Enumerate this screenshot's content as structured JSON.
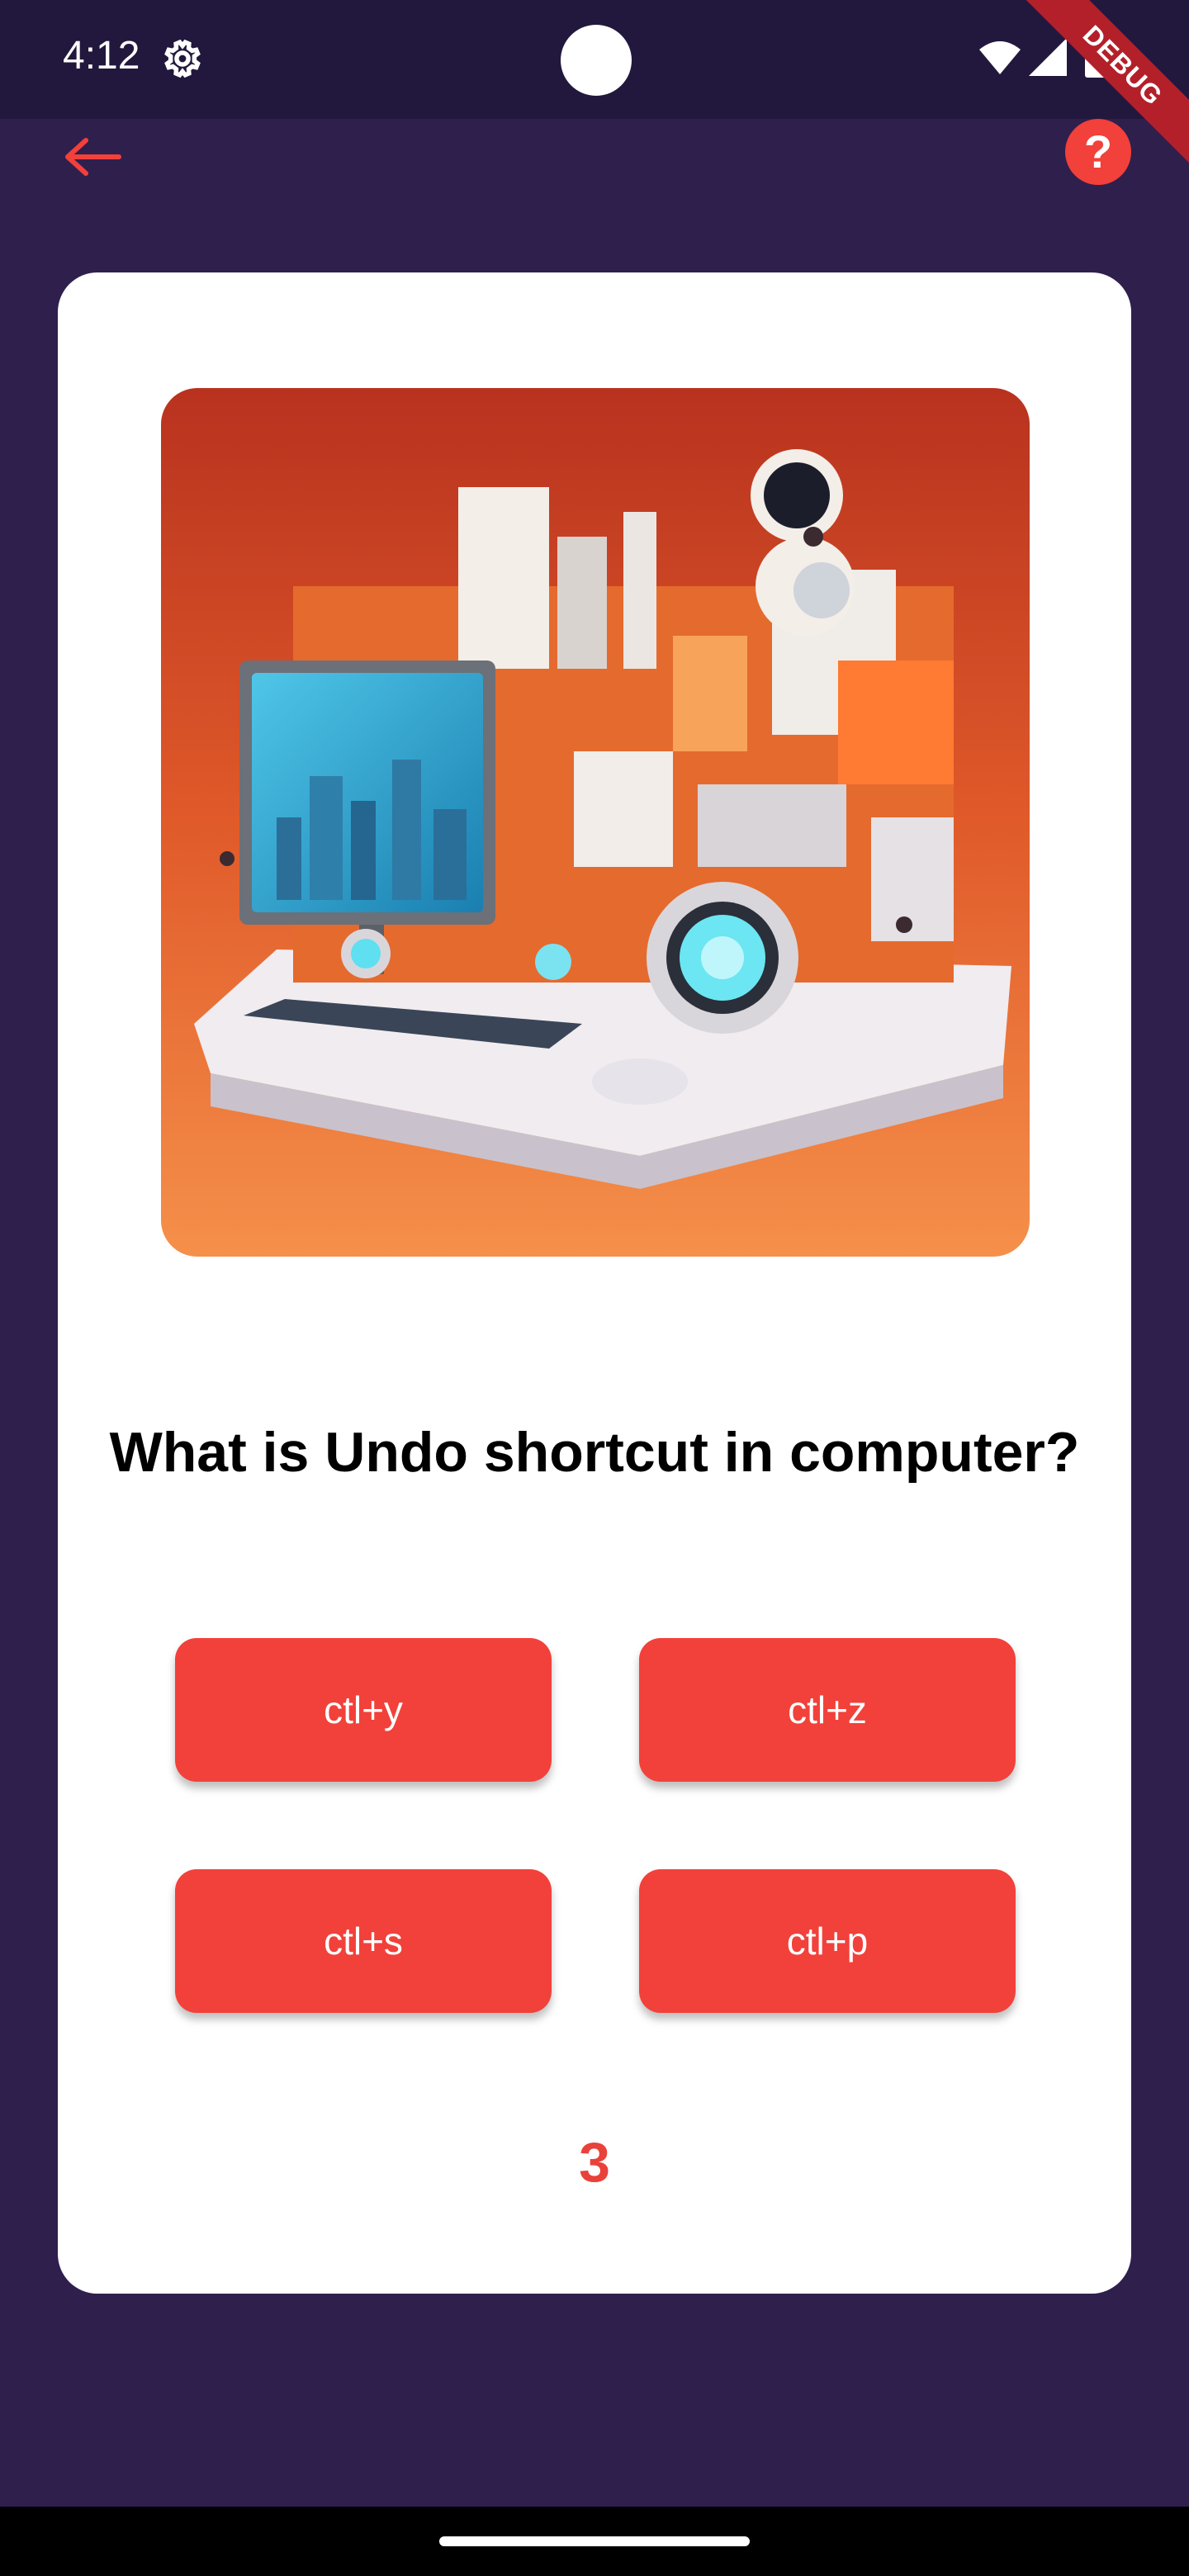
{
  "status_bar": {
    "time": "4:12",
    "debug_label": "DEBUG"
  },
  "app_bar": {
    "back_icon": "arrow-left-icon",
    "help_icon": "help-circle-icon",
    "help_glyph": "?",
    "accent_color": "#f2403a"
  },
  "quiz": {
    "image_icon": "retro-computer-illustration",
    "question": "What is Undo shortcut in computer?",
    "options": [
      {
        "label": "ctl+y"
      },
      {
        "label": "ctl+z"
      },
      {
        "label": "ctl+s"
      },
      {
        "label": "ctl+p"
      }
    ],
    "timer": "3"
  },
  "colors": {
    "background": "#2f1f4d",
    "status_bar": "#22183d",
    "card": "#ffffff",
    "option_button": "#f2413a",
    "timer_text": "#e9423a"
  }
}
